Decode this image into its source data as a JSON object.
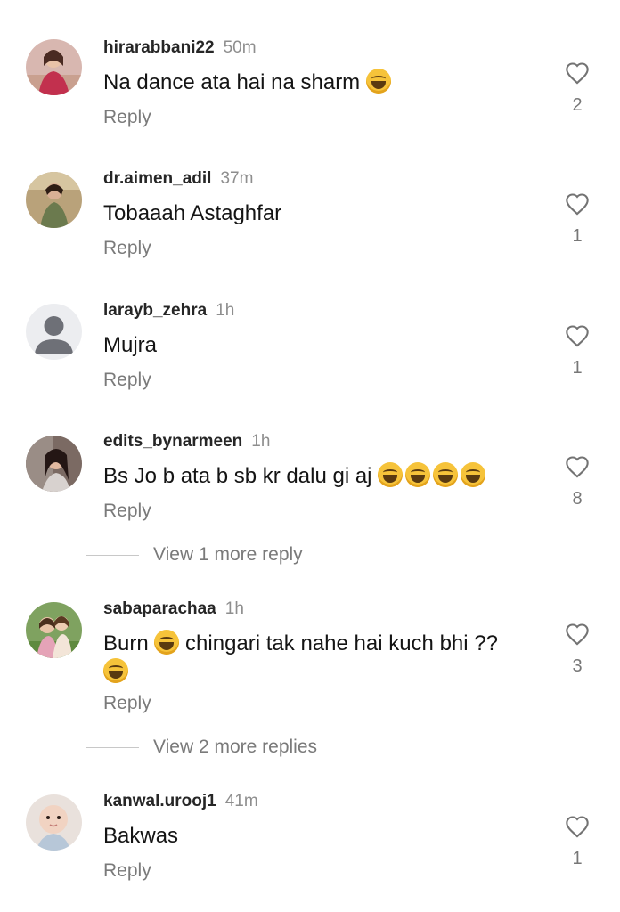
{
  "comments": [
    {
      "username": "hirarabbani22",
      "time": "50m",
      "text": "Na dance ata hai na sharm",
      "emoji_count": 1,
      "reply_label": "Reply",
      "likes": "2",
      "avatar_icon": "profile-photo-woman-pink"
    },
    {
      "username": "dr.aimen_adil",
      "time": "37m",
      "text": "Tobaaah Astaghfar",
      "emoji_count": 0,
      "reply_label": "Reply",
      "likes": "1",
      "avatar_icon": "profile-photo-woman-green"
    },
    {
      "username": "larayb_zehra",
      "time": "1h",
      "text": "Mujra",
      "emoji_count": 0,
      "reply_label": "Reply",
      "likes": "1",
      "avatar_icon": "default-avatar-icon"
    },
    {
      "username": "edits_bynarmeen",
      "time": "1h",
      "text": "Bs Jo b ata b sb kr dalu gi aj",
      "emoji_count": 4,
      "reply_label": "Reply",
      "likes": "8",
      "avatar_icon": "profile-photo-woman-dark",
      "view_more": "View 1 more reply"
    },
    {
      "username": "sabaparachaa",
      "time": "1h",
      "text_part1": "Burn",
      "text_part2": "chingari tak nahe hai kuch bhi ??",
      "reply_label": "Reply",
      "likes": "3",
      "avatar_icon": "profile-photo-children-outdoor",
      "view_more": "View 2 more replies"
    },
    {
      "username": "kanwal.urooj1",
      "time": "41m",
      "text": "Bakwas",
      "emoji_count": 0,
      "reply_label": "Reply",
      "likes": "1",
      "avatar_icon": "profile-photo-baby"
    }
  ],
  "icons": {
    "like": "heart-outline-icon",
    "emoji": "face-with-tears-of-joy-icon"
  },
  "colors": {
    "username": "#262626",
    "secondary": "#8e8e8e",
    "emoji": "#f6c33a"
  }
}
